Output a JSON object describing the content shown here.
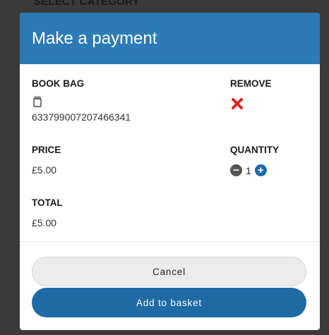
{
  "backdrop": {
    "heading": "SELECT CATEGORY"
  },
  "modal": {
    "title": "Make a payment",
    "item_label": "BOOK BAG",
    "item_code": "633799007207466341",
    "remove_label": "REMOVE",
    "price_label": "PRICE",
    "price_value": "£5.00",
    "quantity_label": "QUANTITY",
    "quantity_value": "1",
    "total_label": "TOTAL",
    "total_value": "£5.00",
    "cancel_label": "Cancel",
    "add_label": "Add to basket"
  },
  "icons": {
    "bag": "book-bag-icon",
    "remove": "close-icon",
    "minus": "minus-circle-icon",
    "plus": "plus-circle-icon"
  },
  "colors": {
    "header": "#2c7bb6",
    "primary": "#1e6aa5",
    "remove": "#e02020",
    "backdrop": "#3a3a3a"
  }
}
